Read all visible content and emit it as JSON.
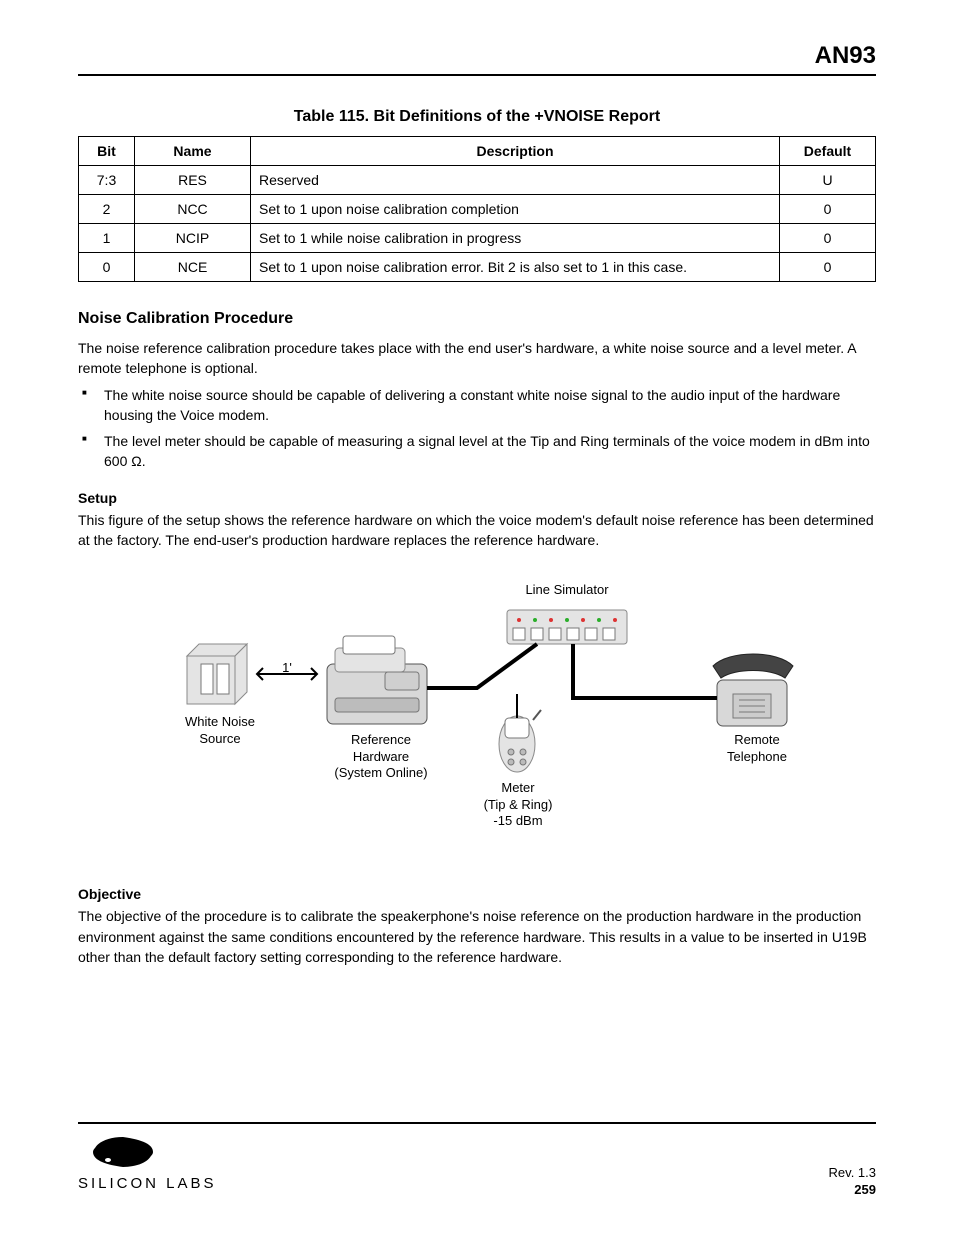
{
  "doc_title": "AN93",
  "table_caption": "Table 115. Bit Definitions of the +VNOISE Report",
  "table": {
    "headers": {
      "bit": "Bit",
      "name": "Name",
      "desc": "Description",
      "def": "Default"
    },
    "rows": [
      {
        "bit": "7:3",
        "name": "RES",
        "desc": "Reserved",
        "def": "U"
      },
      {
        "bit": "2",
        "name": "NCC",
        "desc": "Set to 1 upon noise calibration completion",
        "def": "0"
      },
      {
        "bit": "1",
        "name": "NCIP",
        "desc": "Set to 1 while noise calibration in progress",
        "def": "0"
      },
      {
        "bit": "0",
        "name": "NCE",
        "desc": "Set to 1 upon noise calibration error. Bit 2 is also set to 1 in this case.",
        "def": "0"
      }
    ]
  },
  "section_heading": "Noise Calibration Procedure",
  "intro": "The noise reference calibration procedure takes place with the end user's hardware, a white noise source and a level meter. A remote telephone is optional.",
  "bullets": [
    "The white noise source should be capable of delivering a constant white noise signal to the audio input of the hardware housing the Voice modem.",
    "The level meter should be capable of measuring a signal level at the Tip and Ring terminals of the voice modem in dBm into 600 Ω."
  ],
  "subhead1": "Setup",
  "setup_text": "This figure of the setup shows the reference hardware on which the voice modem's default noise reference has been determined at the factory. The end-user's production hardware replaces the reference hardware.",
  "figure": {
    "line_sim": "Line Simulator",
    "noise_src_l1": "White Noise",
    "noise_src_l2": "Source",
    "ref_hw_l1": "Reference",
    "ref_hw_l2": "Hardware",
    "ref_hw_l3": "(System Online)",
    "meter_l1": "Meter",
    "meter_l2": "(Tip & Ring)",
    "meter_l3": "-15 dBm",
    "remote_l1": "Remote",
    "remote_l2": "Telephone",
    "one_ft": "1'"
  },
  "subhead2": "Objective",
  "objective_text": "The objective of the procedure is to calibrate the speakerphone's noise reference on the production hardware in the production environment against the same conditions encountered by the reference hardware. This results in a value to be inserted in U19B other than the default factory setting corresponding to the reference hardware.",
  "footer": {
    "rev": "Rev. 1.3",
    "page": "259",
    "logo_alt": "Silicon Labs"
  }
}
